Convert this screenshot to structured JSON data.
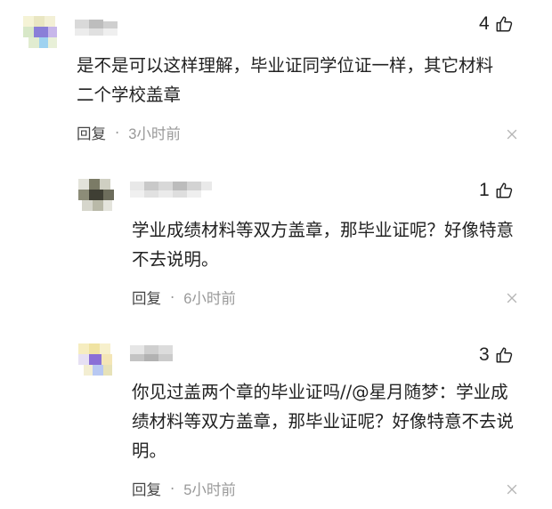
{
  "comments": [
    {
      "likes": "4",
      "text": "是不是可以这样理解，毕业证同学位证一样，其它材料二个学校盖章",
      "reply_label": "回复",
      "separator": "·",
      "time": "3小时前",
      "avatar_colors": [
        "#f2f0c8",
        "#8a7fd8",
        "#9ed2f0",
        "#d9e6bf"
      ]
    },
    {
      "likes": "1",
      "text": "学业成绩材料等双方盖章，那毕业证呢？好像特意不去说明。",
      "reply_label": "回复",
      "separator": "·",
      "time": "6小时前",
      "avatar_colors": [
        "#5b5b4c",
        "#8c8c78",
        "#b9b9a8",
        "#d6d6cc"
      ]
    },
    {
      "likes": "3",
      "text": "你见过盖两个章的毕业证吗//@星月随梦：学业成绩材料等双方盖章，那毕业证呢？好像特意不去说明。",
      "reply_label": "回复",
      "separator": "·",
      "time": "5小时前",
      "avatar_colors": [
        "#f5e7a8",
        "#8a6fd6",
        "#b8c8f2",
        "#e7e2b8"
      ]
    }
  ]
}
